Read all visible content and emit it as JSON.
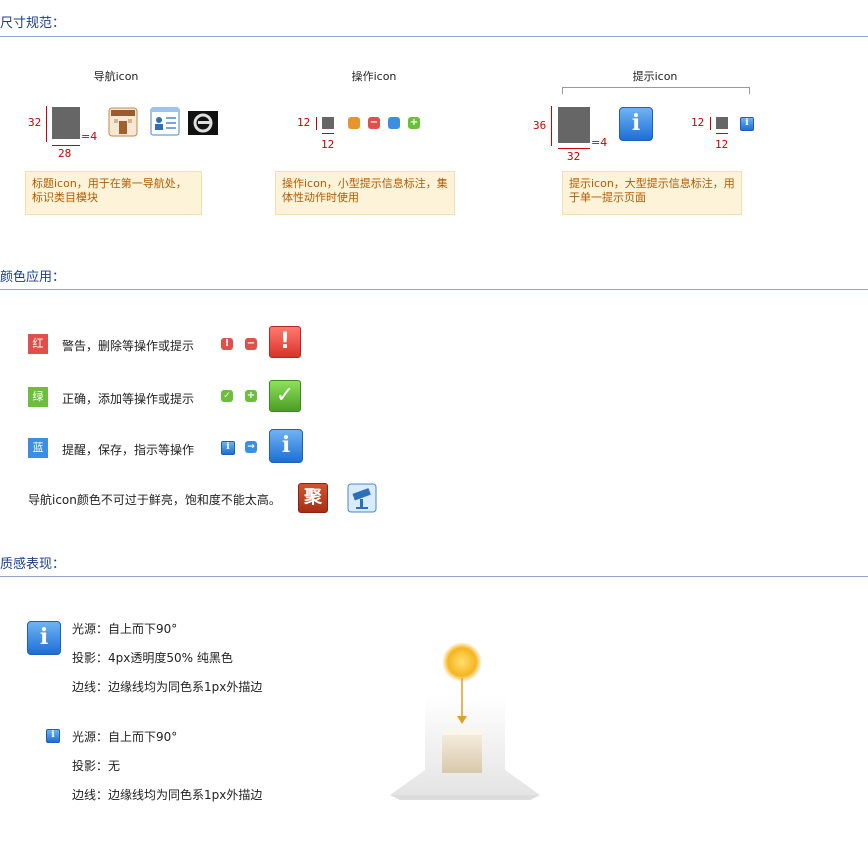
{
  "sections": {
    "size": "尺寸规范：",
    "color": "颜色应用：",
    "texture": "质感表现："
  },
  "size": {
    "nav": {
      "caption": "导航icon",
      "h": "32",
      "w": "28",
      "eq": "=4",
      "note": "标题icon，用于在第一导航处，标识类目模块"
    },
    "op": {
      "caption": "操作icon",
      "h": "12",
      "w": "12",
      "note": "操作icon，小型提示信息标注，集体性动作时使用"
    },
    "tip": {
      "caption": "提示icon",
      "h": "36",
      "w": "32",
      "eq": "=4",
      "small_h": "12",
      "small_w": "12",
      "note": "提示icon，大型提示信息标注，用于单一提示页面"
    }
  },
  "colors": {
    "red": {
      "chip": "红",
      "text": "警告，删除等操作或提示",
      "color": "#e0504a"
    },
    "green": {
      "chip": "绿",
      "text": "正确，添加等操作或提示",
      "color": "#6cbf3a"
    },
    "blue": {
      "chip": "蓝",
      "text": "提醒，保存，指示等操作",
      "color": "#3b8fe0"
    },
    "nav_note": "导航icon颜色不可过于鲜亮，饱和度不能太高。",
    "nav_icon_char": "聚"
  },
  "texture": {
    "big": {
      "light": "光源：自上而下90°",
      "shadow": "投影：4px透明度50% 纯黑色",
      "edge": "边线：边缘线均为同色系1px外描边"
    },
    "small": {
      "light": "光源：自上而下90°",
      "shadow": "投影：无",
      "edge": "边线：边缘线均为同色系1px外描边"
    }
  }
}
